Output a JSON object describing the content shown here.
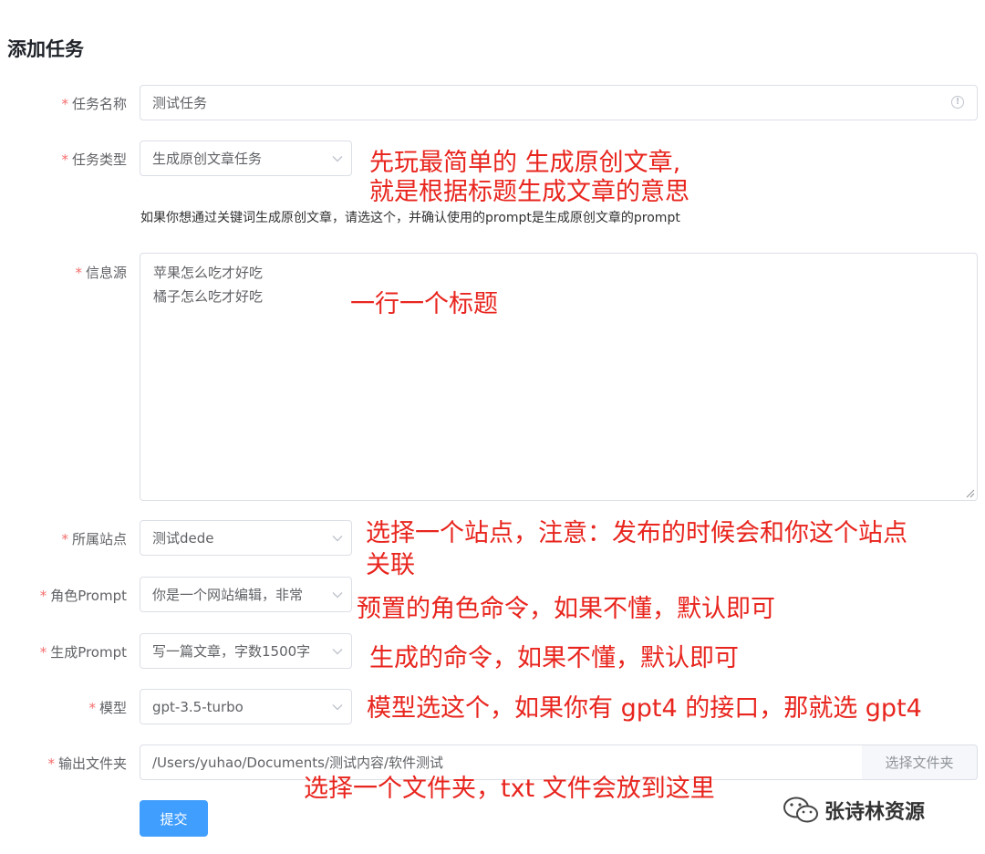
{
  "page": {
    "title": "添加任务"
  },
  "form": {
    "task_name": {
      "label": "任务名称",
      "value": "测试任务"
    },
    "task_type": {
      "label": "任务类型",
      "value": "生成原创文章任务",
      "hint": "如果你想通过关键词生成原创文章，请选这个，并确认使用的prompt是生成原创文章的prompt"
    },
    "source": {
      "label": "信息源",
      "lines": [
        "苹果怎么吃才好吃",
        "橘子怎么吃才好吃"
      ]
    },
    "site": {
      "label": "所属站点",
      "value": "测试dede"
    },
    "role_prompt": {
      "label": "角色Prompt",
      "value": "你是一个网站编辑，非常"
    },
    "gen_prompt": {
      "label": "生成Prompt",
      "value": "写一篇文章，字数1500字"
    },
    "model": {
      "label": "模型",
      "value": "gpt-3.5-turbo"
    },
    "output_folder": {
      "label": "输出文件夹",
      "value": "/Users/yuhao/Documents/测试内容/软件测试",
      "button": "选择文件夹"
    },
    "required_mark": "*",
    "submit": "提交"
  },
  "annotations": {
    "task_type_1": "先玩最简单的 生成原创文章,",
    "task_type_2": "就是根据标题生成文章的意思",
    "source": "一行一个标题",
    "site_1": "选择一个站点，注意：发布的时候会和你这个站点",
    "site_2": "关联",
    "role_prompt": "预置的角色命令，如果不懂，默认即可",
    "gen_prompt": "生成的命令，如果不懂，默认即可",
    "model": "模型选这个，如果你有 gpt4 的接口，那就选 gpt4",
    "output_folder": "选择一个文件夹，txt 文件会放到这里"
  },
  "watermark": "张诗林资源",
  "colors": {
    "primary": "#409eff",
    "annotation": "#e8251e",
    "required": "#f56c6c",
    "border": "#dcdfe6"
  }
}
